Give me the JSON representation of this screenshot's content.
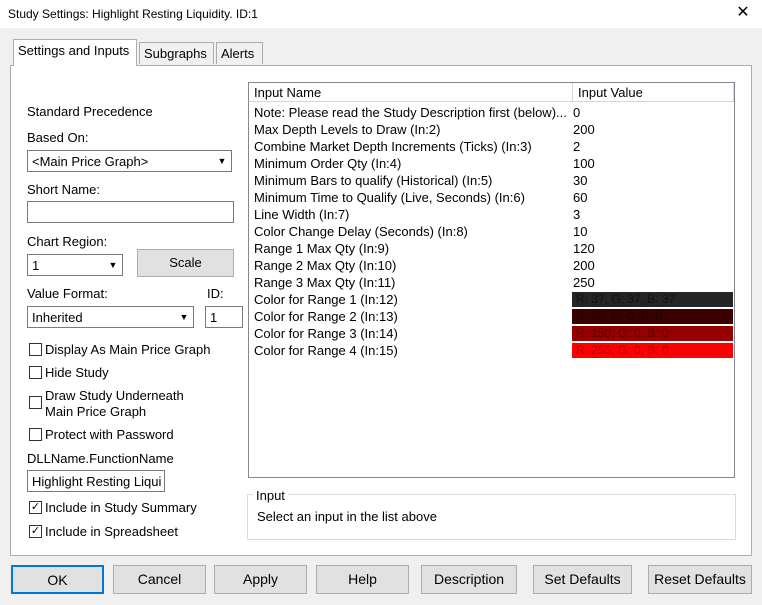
{
  "window": {
    "title": "Study Settings: Highlight Resting Liquidity. ID:1",
    "close_glyph": "✕"
  },
  "tabs": [
    "Settings and Inputs",
    "Subgraphs",
    "Alerts"
  ],
  "left": {
    "standard_precedence": "Standard Precedence",
    "based_on_label": "Based On:",
    "based_on_value": "<Main Price Graph>",
    "short_name_label": "Short Name:",
    "short_name_value": "",
    "chart_region_label": "Chart Region:",
    "chart_region_value": "1",
    "scale_button": "Scale",
    "value_format_label": "Value Format:",
    "value_format_value": "Inherited",
    "id_label": "ID:",
    "id_value": "1",
    "checkboxes": [
      {
        "label": "Display As Main Price Graph",
        "checked": false
      },
      {
        "label": "Hide Study",
        "checked": false
      },
      {
        "label": "Draw Study Underneath",
        "label2": "Main Price Graph",
        "checked": false
      },
      {
        "label": "Protect with Password",
        "checked": false
      }
    ],
    "dll_label": "DLLName.FunctionName",
    "dll_value": "Highlight Resting Liqui",
    "include_summary": {
      "label": "Include in Study Summary",
      "checked": true
    },
    "include_spreadsheet": {
      "label": "Include in Spreadsheet",
      "checked": true
    }
  },
  "grid": {
    "col_name": "Input Name",
    "col_value": "Input Value",
    "rows": [
      {
        "name": "Note: Please read the Study Description first (below)...",
        "value": "0"
      },
      {
        "name": "Max Depth Levels to Draw  (In:2)",
        "value": "200"
      },
      {
        "name": "Combine Market Depth Increments (Ticks)  (In:3)",
        "value": "2"
      },
      {
        "name": "Minimum Order Qty  (In:4)",
        "value": "100"
      },
      {
        "name": "Minimum Bars to qualify (Historical)  (In:5)",
        "value": "30"
      },
      {
        "name": "Minimum Time to Qualify (Live, Seconds)  (In:6)",
        "value": "60"
      },
      {
        "name": "Line Width  (In:7)",
        "value": "3"
      },
      {
        "name": "Color Change Delay (Seconds)  (In:8)",
        "value": "10"
      },
      {
        "name": "Range 1 Max Qty  (In:9)",
        "value": "120"
      },
      {
        "name": "Range 2 Max Qty  (In:10)",
        "value": "200"
      },
      {
        "name": "Range 3 Max Qty  (In:11)",
        "value": "250"
      },
      {
        "name": "Color for Range 1  (In:12)",
        "value": "R: 37, G: 37, B: 37",
        "color": "#252525"
      },
      {
        "name": "Color for Range 2  (In:13)",
        "value": "R: 58, G: 0, B: 0",
        "color": "#3a0000"
      },
      {
        "name": "Color for Range 3  (In:14)",
        "value": "R: 150, G: 0, B: 0",
        "color": "#960000"
      },
      {
        "name": "Color for Range 4  (In:15)",
        "value": "R: 255, G: 0, B: 0",
        "color": "#ff0000"
      }
    ]
  },
  "input_box": {
    "label": "Input",
    "text": "Select an input in the list above"
  },
  "buttons": [
    "OK",
    "Cancel",
    "Apply",
    "Help",
    "Description",
    "Set Defaults",
    "Reset Defaults"
  ]
}
